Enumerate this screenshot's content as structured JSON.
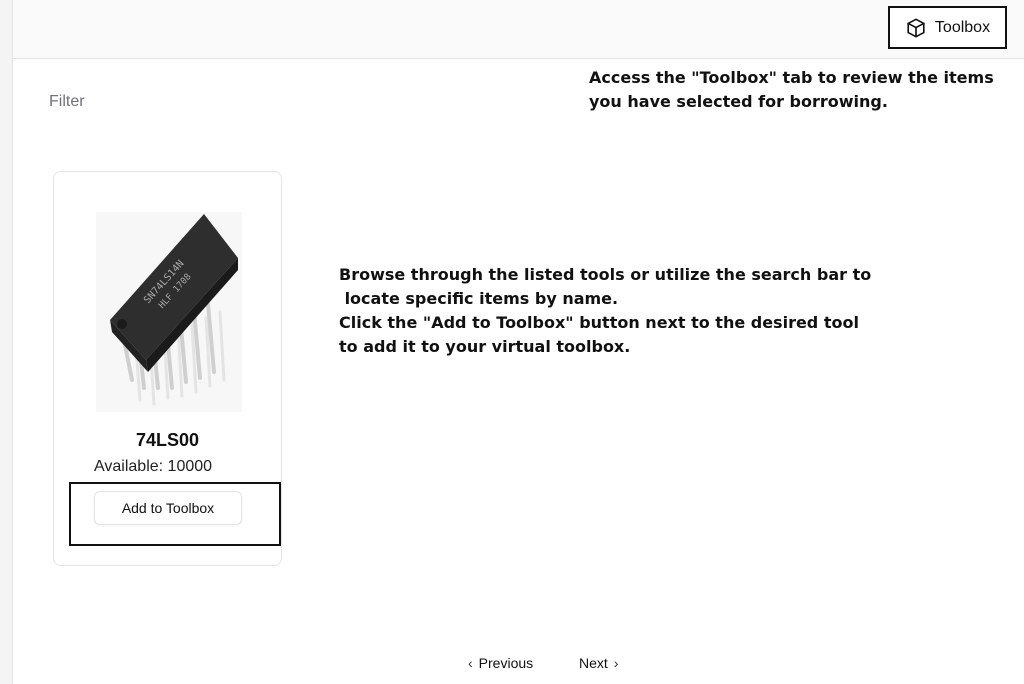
{
  "topbar": {
    "toolbox_label": "Toolbox",
    "toolbox_icon": "package-icon"
  },
  "filter": {
    "label": "Filter"
  },
  "notes": {
    "top": "Access the \"Toolbox\" tab to review the items\nyou have selected for borrowing.",
    "middle": "Browse through the listed tools or utilize the search bar to\n locate specific items by name.\nClick the \"Add to Toolbox\" button next to the desired tool\nto add it to your virtual toolbox."
  },
  "product": {
    "name": "74LS00",
    "available_label": "Available:",
    "available_count": "10000",
    "add_label": "Add to Toolbox",
    "chip_marking_1": "SN74LS14N",
    "chip_marking_2": "HLF   1708"
  },
  "pagination": {
    "previous_label": "Previous",
    "next_label": "Next",
    "previous_icon": "chevron-left-icon",
    "next_icon": "chevron-right-icon"
  }
}
